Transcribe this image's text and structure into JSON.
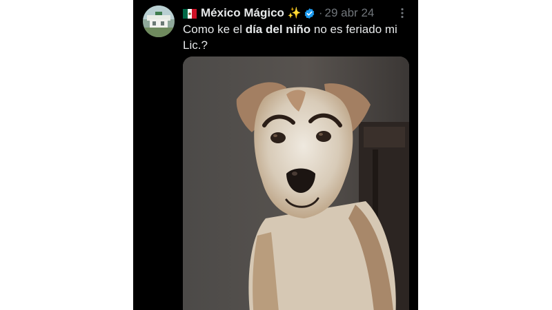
{
  "author": {
    "display_name": "México Mágico",
    "sparkles": "✨",
    "separator": "·",
    "date": "29 abr 24"
  },
  "tweet": {
    "text_part1": "Como ke el ",
    "text_bold": "día del niño",
    "text_part2": " no es feriado mi Lic.?"
  },
  "icons": {
    "flag": "mexico-flag-icon",
    "verified": "verified-badge-icon",
    "more": "more-options-icon"
  },
  "colors": {
    "background": "#000000",
    "text": "#e7e9ea",
    "secondary_text": "#71767b",
    "verified": "#1d9bf0"
  }
}
